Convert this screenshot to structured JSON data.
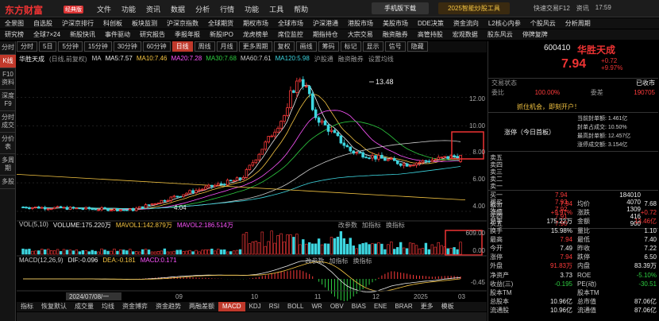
{
  "app": {
    "logo": "东方财富",
    "edition": "经典版",
    "menu": [
      "文件",
      "功能",
      "资讯",
      "数据",
      "分析",
      "行情",
      "功能",
      "工具",
      "帮助"
    ],
    "mobile_button": "手机版下载",
    "promo": "2025智能炒股工具",
    "right": [
      "快速交易F12",
      "资讯",
      "17:59"
    ]
  },
  "nav": {
    "row1": [
      "全景图",
      "自选股",
      "沪深京排行",
      "科创板",
      "板块监测",
      "沪深京指数",
      "全球期货",
      "期权市场",
      "全球市场",
      "沪深港通",
      "港股市场",
      "美股市场",
      "DDE决策",
      "资金流向",
      "L2核心内参",
      "个股风云",
      "分析周期"
    ],
    "row2": [
      "研究榜",
      "全球7×24",
      "新股快讯",
      "事件驱动",
      "研究报告",
      "季报年报",
      "新股IPO",
      "龙虎榜单",
      "席位监控",
      "期指持仓",
      "大宗交易",
      "融资融券",
      "高管持股",
      "宏观数据",
      "股东风云",
      "停牌复牌"
    ]
  },
  "left_tabs": [
    "分时",
    "K线",
    "F10资料",
    "深度F9",
    "分时成交",
    "分价表",
    "多周期",
    "多股"
  ],
  "chart_toolbar": [
    "分时",
    "5日",
    "5分钟",
    "15分钟",
    "30分钟",
    "60分钟",
    "日线",
    "周线",
    "月线",
    "更多周期",
    "复权",
    "画线",
    "筹码",
    "标记",
    "显示",
    "信号",
    "隐藏"
  ],
  "chart_toolbar_active": "日线",
  "main_legend": {
    "name": "华胜天成",
    "mode": "(日线,前复权)",
    "items": [
      {
        "label": "MA",
        "color": "#cccccc"
      },
      {
        "label": "MA5:7.57",
        "color": "#eeeeee"
      },
      {
        "label": "MA10:7.46",
        "color": "#f5c542"
      },
      {
        "label": "MA20:7.28",
        "color": "#ff55ff"
      },
      {
        "label": "MA30:7.68",
        "color": "#2ecc40"
      },
      {
        "label": "MA60:7.61",
        "color": "#cccccc"
      },
      {
        "label": "MA120:5.98",
        "color": "#3dd6e0"
      }
    ],
    "extras": [
      "沪股通",
      "融资融券",
      "设置均线"
    ]
  },
  "vol_legend": [
    {
      "label": "VOL(5,10)",
      "color": "#cccccc"
    },
    {
      "label": "VOLUME:175.220万",
      "color": "#eeeeee"
    },
    {
      "label": "MAVOL1:142.879万",
      "color": "#f5c542"
    },
    {
      "label": "MAVOL2:186.514万",
      "color": "#ff55ff"
    }
  ],
  "vol_extras": [
    "改参数",
    "加指标",
    "换指标"
  ],
  "macd_legend": [
    {
      "label": "MACD(12,26,9)",
      "color": "#cccccc"
    },
    {
      "label": "DIF:-0.096",
      "color": "#eeeeee"
    },
    {
      "label": "DEA:-0.181",
      "color": "#f5c542"
    },
    {
      "label": "MACD:0.171",
      "color": "#ff55ff"
    }
  ],
  "macd_extras": [
    "改参数",
    "加指标",
    "换指标"
  ],
  "y_axis": {
    "price": [
      "12.00",
      "10.00",
      "8.00",
      "6.00",
      "4.00"
    ],
    "volume": [
      "609.00",
      "0.00"
    ],
    "macd": [
      "-0.45"
    ],
    "unit": "万"
  },
  "peak_label": "13.48",
  "low_label": "4.04",
  "x_axis": {
    "start": "2024/07/08/一",
    "labels": [
      "09",
      "10",
      "11",
      "12",
      "2025",
      "03"
    ]
  },
  "bottom_tabs": [
    "指标",
    "恢复默认",
    "成交量",
    "均线",
    "资金博弈",
    "资金趋势",
    "两融差额",
    "MACD",
    "KDJ",
    "RSI",
    "BOLL",
    "WR",
    "OBV",
    "BIAS",
    "ENE",
    "BRAR",
    "更多",
    "模板"
  ],
  "bottom_tabs_active": "MACD",
  "chart_data": {
    "type": "candlestick",
    "dates": [
      "2024-07",
      "2024-08",
      "2024-09",
      "2024-10",
      "2024-11",
      "2024-12",
      "2025-01",
      "2025-02",
      "2025-03"
    ],
    "close": [
      4.3,
      4.2,
      4.1,
      5.3,
      6.3,
      12.0,
      8.2,
      7.3,
      7.94
    ],
    "high": [
      4.6,
      4.4,
      4.5,
      6.0,
      7.2,
      13.48,
      10.0,
      8.6,
      8.1
    ],
    "low": [
      4.1,
      4.04,
      4.0,
      4.5,
      5.6,
      8.0,
      7.0,
      6.7,
      7.2
    ],
    "volume_max": 609.0,
    "ylim": [
      4.0,
      13.48
    ]
  },
  "quote": {
    "code": "600410",
    "name": "华胜天成",
    "price": "7.94",
    "change": "+0.72",
    "change_pct": "+9.97%",
    "status_label": "交易状态",
    "status_value": "已收市",
    "ratio_label": "委比",
    "ratio_value": "100.00%",
    "diff_label": "委差",
    "diff_value": "190705",
    "trade_link": "抓住机会，即刻开户！",
    "limit_label": "涨停（今日首板）",
    "limit_lines": [
      "当前封单额: 1.461亿",
      "封单占成交: 10.50%",
      "最高封单额: 12.457亿",
      "涨停成交额: 3.154亿"
    ],
    "sell": [
      {
        "label": "卖五",
        "price": "",
        "vol": ""
      },
      {
        "label": "卖四",
        "price": "",
        "vol": ""
      },
      {
        "label": "卖三",
        "price": "",
        "vol": ""
      },
      {
        "label": "卖二",
        "price": "",
        "vol": ""
      },
      {
        "label": "卖一",
        "price": "",
        "vol": ""
      }
    ],
    "buy": [
      {
        "label": "买一",
        "price": "7.94",
        "vol": "184010"
      },
      {
        "label": "买二",
        "price": "7.93",
        "vol": "4070"
      },
      {
        "label": "买三",
        "price": "7.92",
        "vol": "1309"
      },
      {
        "label": "买四",
        "price": "7.91",
        "vol": "416"
      },
      {
        "label": "买五",
        "price": "7.90",
        "vol": "900"
      }
    ],
    "stats": [
      [
        "最新",
        "7.94",
        "均价",
        "7.68"
      ],
      [
        "涨幅",
        "+9.97%",
        "涨跌",
        "+0.72"
      ],
      [
        "总手",
        "175.22万",
        "金额",
        "13.46亿"
      ],
      [
        "换手",
        "15.98%",
        "量比",
        "1.10"
      ],
      [
        "最高",
        "7.94",
        "最低",
        "7.40"
      ],
      [
        "今开",
        "7.49",
        "昨收",
        "7.22"
      ],
      [
        "涨停",
        "7.94",
        "跌停",
        "6.50"
      ],
      [
        "外盘",
        "91.83万",
        "内盘",
        "83.39万"
      ],
      [
        "净资产",
        "3.73",
        "ROE",
        "-5.10%"
      ],
      [
        "收益(三)",
        "-0.195",
        "PE(动)",
        "-30.51"
      ],
      [
        "股本TM",
        "",
        "股本TM",
        ""
      ],
      [
        "总股本",
        "10.96亿",
        "总市值",
        "87.06亿"
      ],
      [
        "流通股",
        "10.96亿",
        "流通值",
        "87.06亿"
      ]
    ]
  }
}
